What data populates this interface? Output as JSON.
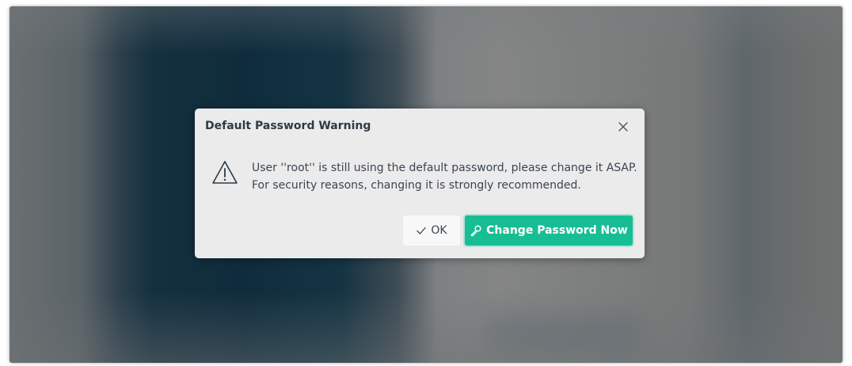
{
  "dialog": {
    "title": "Default Password Warning",
    "message_line1": "User ''root'' is still using the default password, please change it ASAP.",
    "message_line2": "For security reasons, changing it is strongly recommended.",
    "ok_label": "OK",
    "primary_label": "Change Password Now",
    "icons": {
      "close": "close-icon",
      "warning": "warning-icon",
      "ok": "checkmark-icon",
      "primary": "key-icon"
    }
  },
  "colors": {
    "primary_button": "#18be93",
    "dialog_background": "#ebebeb",
    "title_text": "#2f3a44"
  }
}
